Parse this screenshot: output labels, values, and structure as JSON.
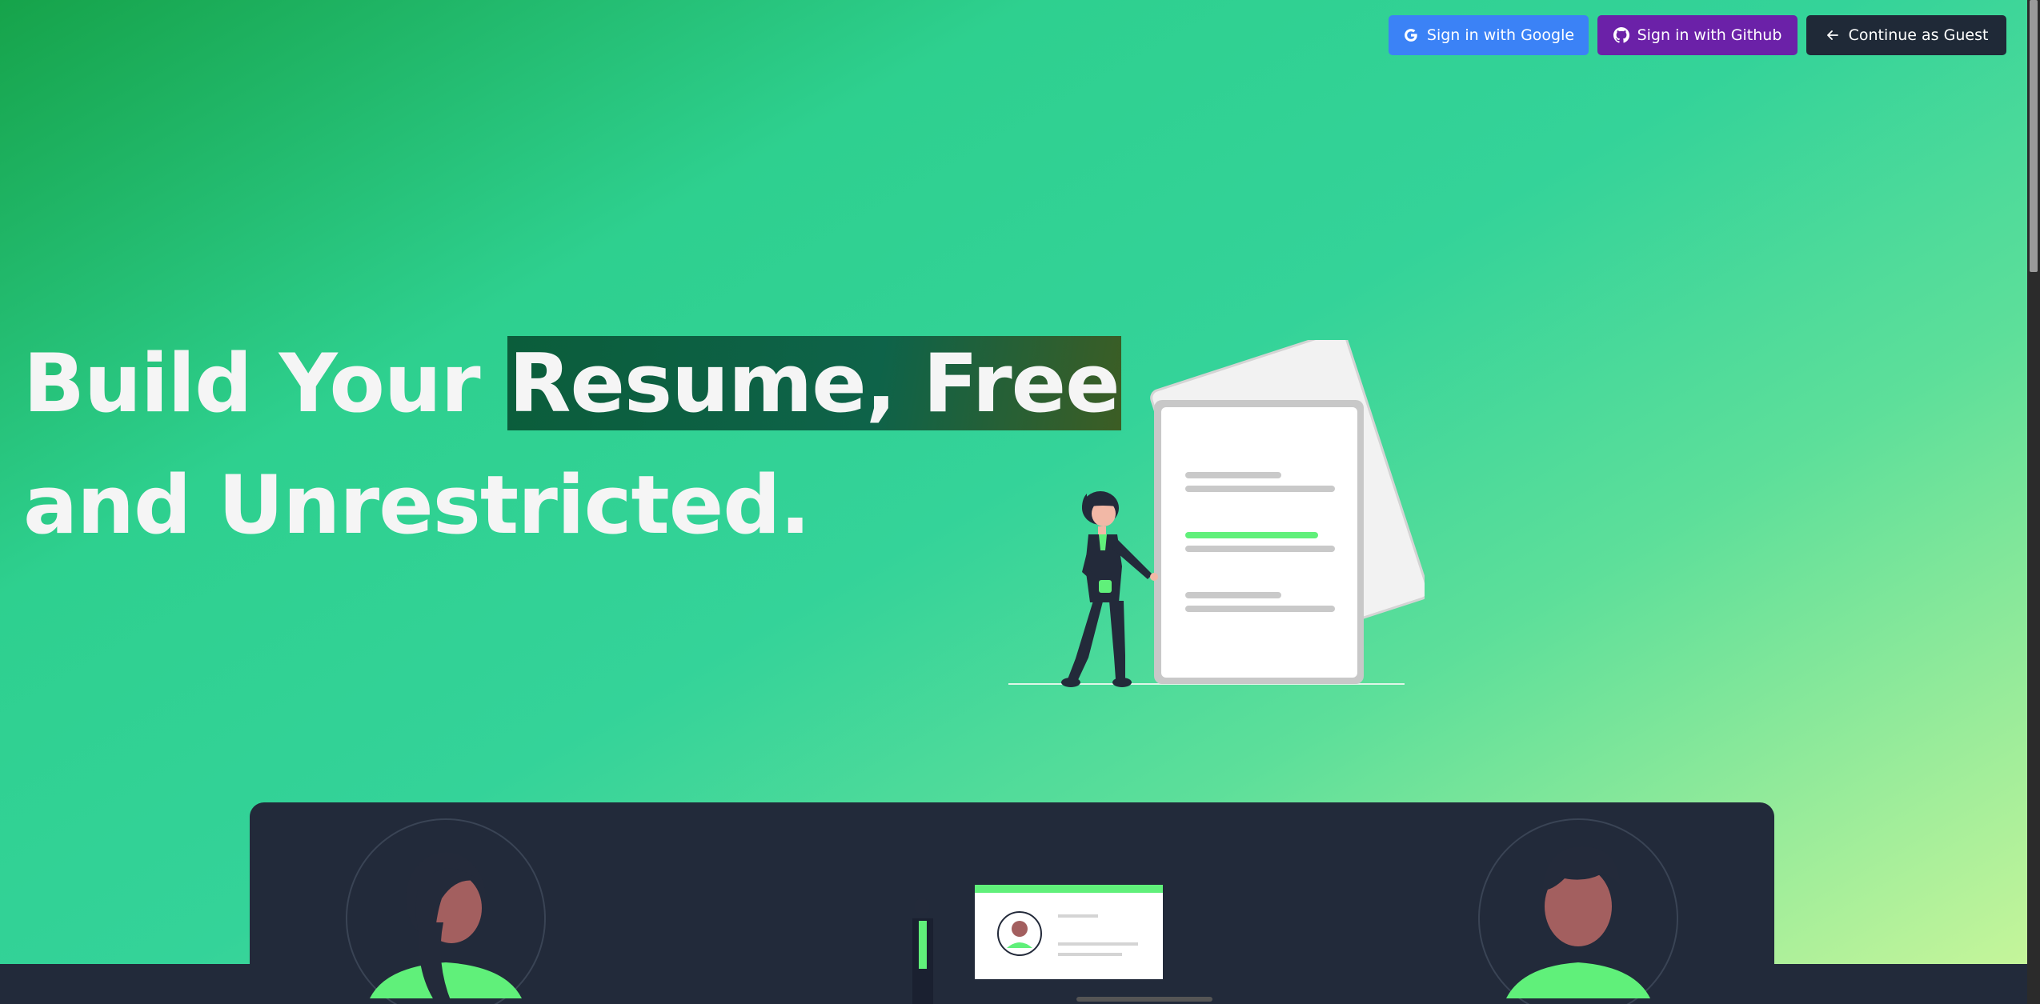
{
  "auth": {
    "google_label": "Sign in with Google",
    "github_label": "Sign in with Github",
    "guest_label": "Continue as Guest",
    "google_icon": "google-icon",
    "github_icon": "github-icon",
    "guest_icon": "arrow-left-icon"
  },
  "hero": {
    "title_part1": "Build Your ",
    "title_highlight": "Resume, Free",
    "title_line2": "and Unrestricted."
  },
  "colors": {
    "google": "#3b82f6",
    "github": "#6b21a8",
    "guest": "#1f2937",
    "accent_green": "#60f07a",
    "panel": "#222a3a"
  }
}
